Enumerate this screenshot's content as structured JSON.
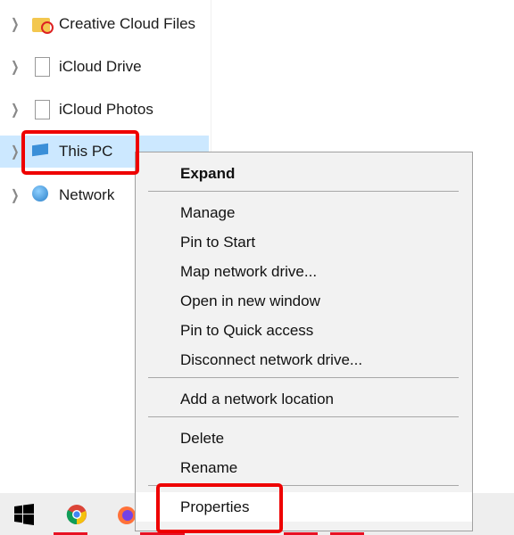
{
  "nav_items": [
    {
      "label": "Creative Cloud Files",
      "icon": "creative-cloud-folder-icon"
    },
    {
      "label": "iCloud Drive",
      "icon": "document-icon"
    },
    {
      "label": "iCloud Photos",
      "icon": "document-icon"
    },
    {
      "label": "This PC",
      "icon": "computer-icon",
      "selected": true
    },
    {
      "label": "Network",
      "icon": "network-icon"
    }
  ],
  "context_menu": {
    "expand": "Expand",
    "manage": "Manage",
    "pin_start": "Pin to Start",
    "map_drive": "Map network drive...",
    "open_new": "Open in new window",
    "pin_quick": "Pin to Quick access",
    "disconnect": "Disconnect network drive...",
    "add_location": "Add a network location",
    "delete": "Delete",
    "rename": "Rename",
    "properties": "Properties"
  },
  "taskbar": {
    "icons": [
      "windows-start-icon",
      "chrome-icon",
      "firefox-icon"
    ]
  },
  "colors": {
    "highlight": "#e00000",
    "selection": "#cce8ff"
  }
}
